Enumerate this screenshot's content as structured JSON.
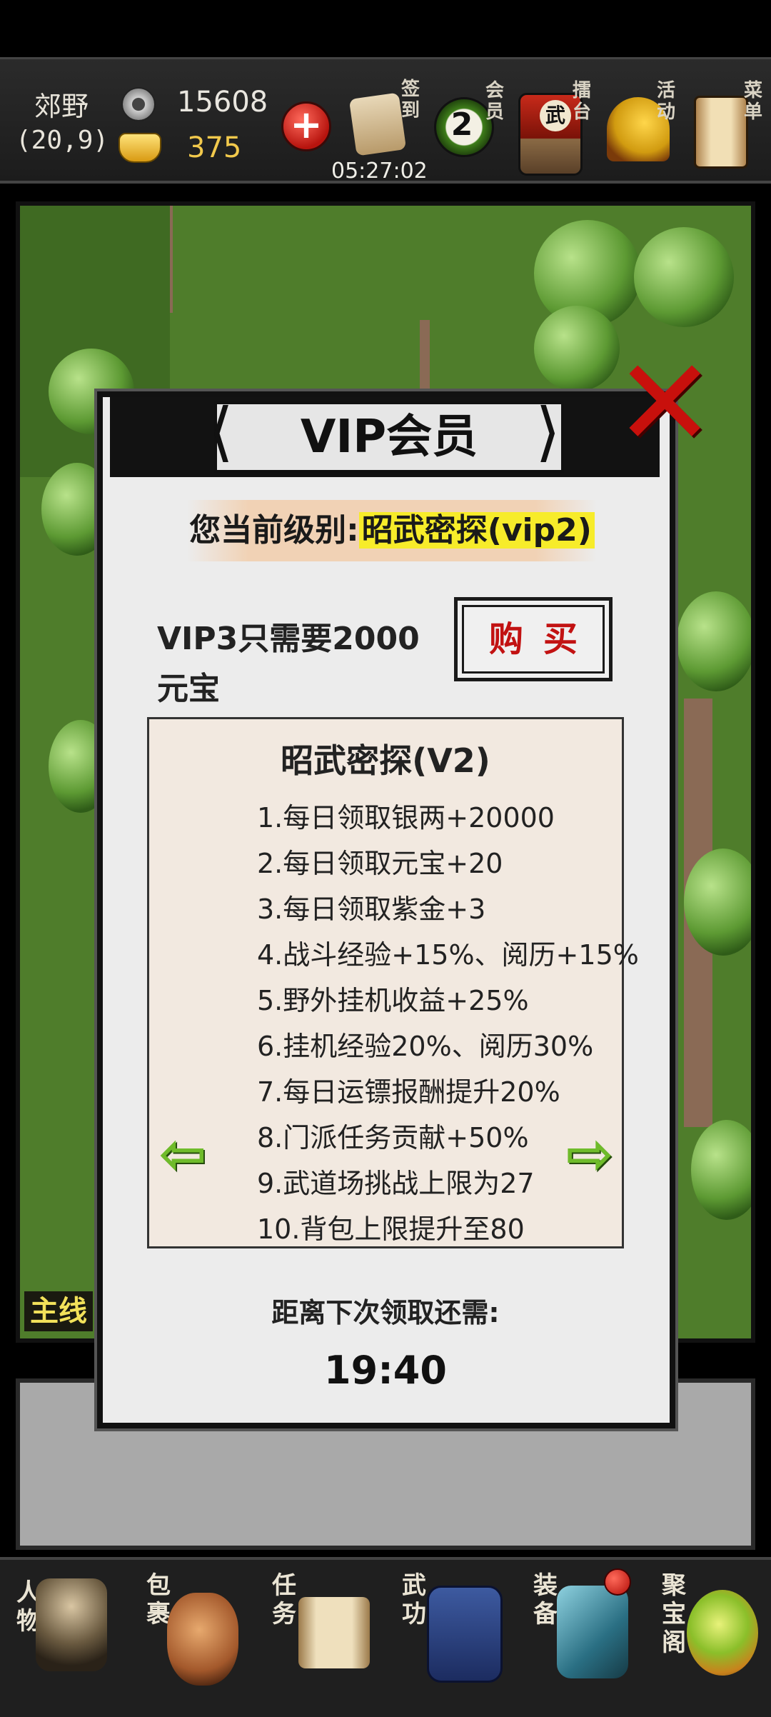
{
  "player": {
    "name": "郊野",
    "coords": "(20,9)"
  },
  "currency": {
    "silver": "15608",
    "gold": "375"
  },
  "top_menu": {
    "sign_in": "签到",
    "sign_in_timer": "05:27:02",
    "vip": "会员",
    "vip_level_badge": "2",
    "arena": "擂台",
    "arena_icon_text": "武",
    "events": "活动",
    "menu": "菜单"
  },
  "quest_tag": "主线",
  "modal": {
    "title": "VIP会员",
    "current_level_prefix": "您当前级别:",
    "current_level_value": "昭武密探(vip2)",
    "upgrade_text": "VIP3只需要2000元宝",
    "buy_label": "购买",
    "benefit_title": "昭武密探(V2)",
    "benefits": [
      "1.每日领取银两+20000",
      "2.每日领取元宝+20",
      "3.每日领取紫金+3",
      "4.战斗经验+15%、阅历+15%",
      "5.野外挂机收益+25%",
      "6.挂机经验20%、阅历30%",
      "7.每日运镖报酬提升20%",
      "8.门派任务贡献+50%",
      "9.武道场挑战上限为27",
      "10.背包上限提升至80"
    ],
    "countdown_label": "距离下次领取还需:",
    "countdown": "19:40"
  },
  "bottom_nav": {
    "character": "人物",
    "bag": "包裹",
    "tasks": "任务",
    "martial": "武功",
    "equipment": "装备",
    "treasure": "聚宝阁"
  },
  "colors": {
    "accent_red": "#c21212",
    "gold": "#f2c94c",
    "highlight": "#f7ec2a",
    "arrow_green": "#6fbb2a"
  }
}
